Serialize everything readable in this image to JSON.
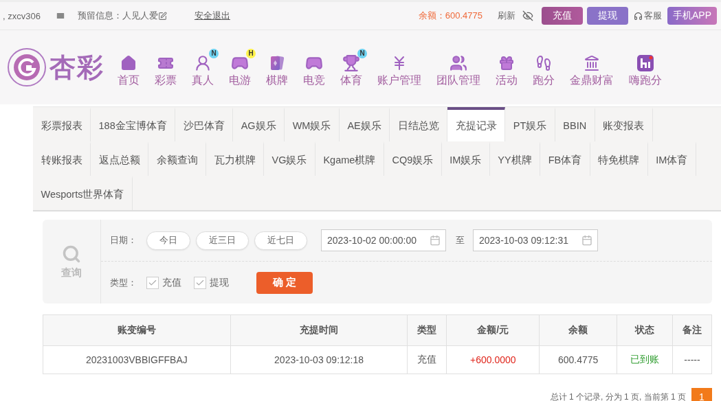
{
  "topbar": {
    "username": ", zxcv306",
    "reserved_info": "预留信息：人见人爱",
    "logout": "安全退出",
    "balance": "余额：600.4775",
    "refresh": "刷新",
    "deposit": "充值",
    "withdraw": "提现",
    "service": "客服",
    "app": "手机APP"
  },
  "logo": {
    "text": "杏彩"
  },
  "nav": [
    {
      "label": "首页"
    },
    {
      "label": "彩票"
    },
    {
      "label": "真人",
      "badge": "N"
    },
    {
      "label": "电游",
      "badge": "H"
    },
    {
      "label": "棋牌"
    },
    {
      "label": "电竞"
    },
    {
      "label": "体育",
      "badge": "N"
    },
    {
      "label": "账户管理"
    },
    {
      "label": "团队管理"
    },
    {
      "label": "活动"
    },
    {
      "label": "跑分"
    },
    {
      "label": "金鼎财富"
    },
    {
      "label": "嗨跑分"
    }
  ],
  "tab_rows": [
    [
      {
        "label": "彩票报表",
        "selected": false
      },
      {
        "label": "188金宝博体育",
        "selected": false
      },
      {
        "label": "沙巴体育",
        "selected": false
      },
      {
        "label": "AG娱乐",
        "selected": false
      },
      {
        "label": "WM娱乐",
        "selected": false
      },
      {
        "label": "AE娱乐",
        "selected": false
      },
      {
        "label": "日结总览",
        "selected": false
      },
      {
        "label": "充提记录",
        "selected": true
      },
      {
        "label": "PT娱乐",
        "selected": false
      },
      {
        "label": "BBIN",
        "selected": false
      },
      {
        "label": "账变报表",
        "selected": false
      }
    ],
    [
      {
        "label": "转账报表",
        "selected": false
      },
      {
        "label": "返点总额",
        "selected": false
      },
      {
        "label": "余额查询",
        "selected": false
      },
      {
        "label": "瓦力棋牌",
        "selected": false
      },
      {
        "label": "VG娱乐",
        "selected": false
      },
      {
        "label": "Kgame棋牌",
        "selected": false
      },
      {
        "label": "CQ9娱乐",
        "selected": false
      },
      {
        "label": "IM娱乐",
        "selected": false
      },
      {
        "label": "YY棋牌",
        "selected": false
      },
      {
        "label": "FB体育",
        "selected": false
      },
      {
        "label": "特免棋牌",
        "selected": false
      },
      {
        "label": "IM体育",
        "selected": false
      }
    ],
    [
      {
        "label": "Wesports世界体育",
        "selected": false
      }
    ]
  ],
  "search": {
    "title": "查询",
    "date_label": "日期：",
    "quick_dates": [
      "今日",
      "近三日",
      "近七日"
    ],
    "from": "2023-10-02 00:00:00",
    "to_label": "至",
    "to": "2023-10-03 09:12:31",
    "type_label": "类型：",
    "types": [
      {
        "label": "充值",
        "checked": true
      },
      {
        "label": "提现",
        "checked": true
      }
    ],
    "confirm": "确 定"
  },
  "table": {
    "columns": [
      "账变编号",
      "充提时间",
      "类型",
      "金额/元",
      "余额",
      "状态",
      "备注"
    ],
    "rows": [
      {
        "id": "20231003VBBIGFFBAJ",
        "time": "2023-10-03 09:12:18",
        "type": "充值",
        "amount": "+600.0000",
        "balance": "600.4775",
        "status": "已到账",
        "note": "-----"
      }
    ]
  },
  "pagination": {
    "summary": "总计 1 个记录, 分为 1 页, 当前第 1 页",
    "pages": [
      {
        "label": "1",
        "selected": true
      }
    ]
  }
}
